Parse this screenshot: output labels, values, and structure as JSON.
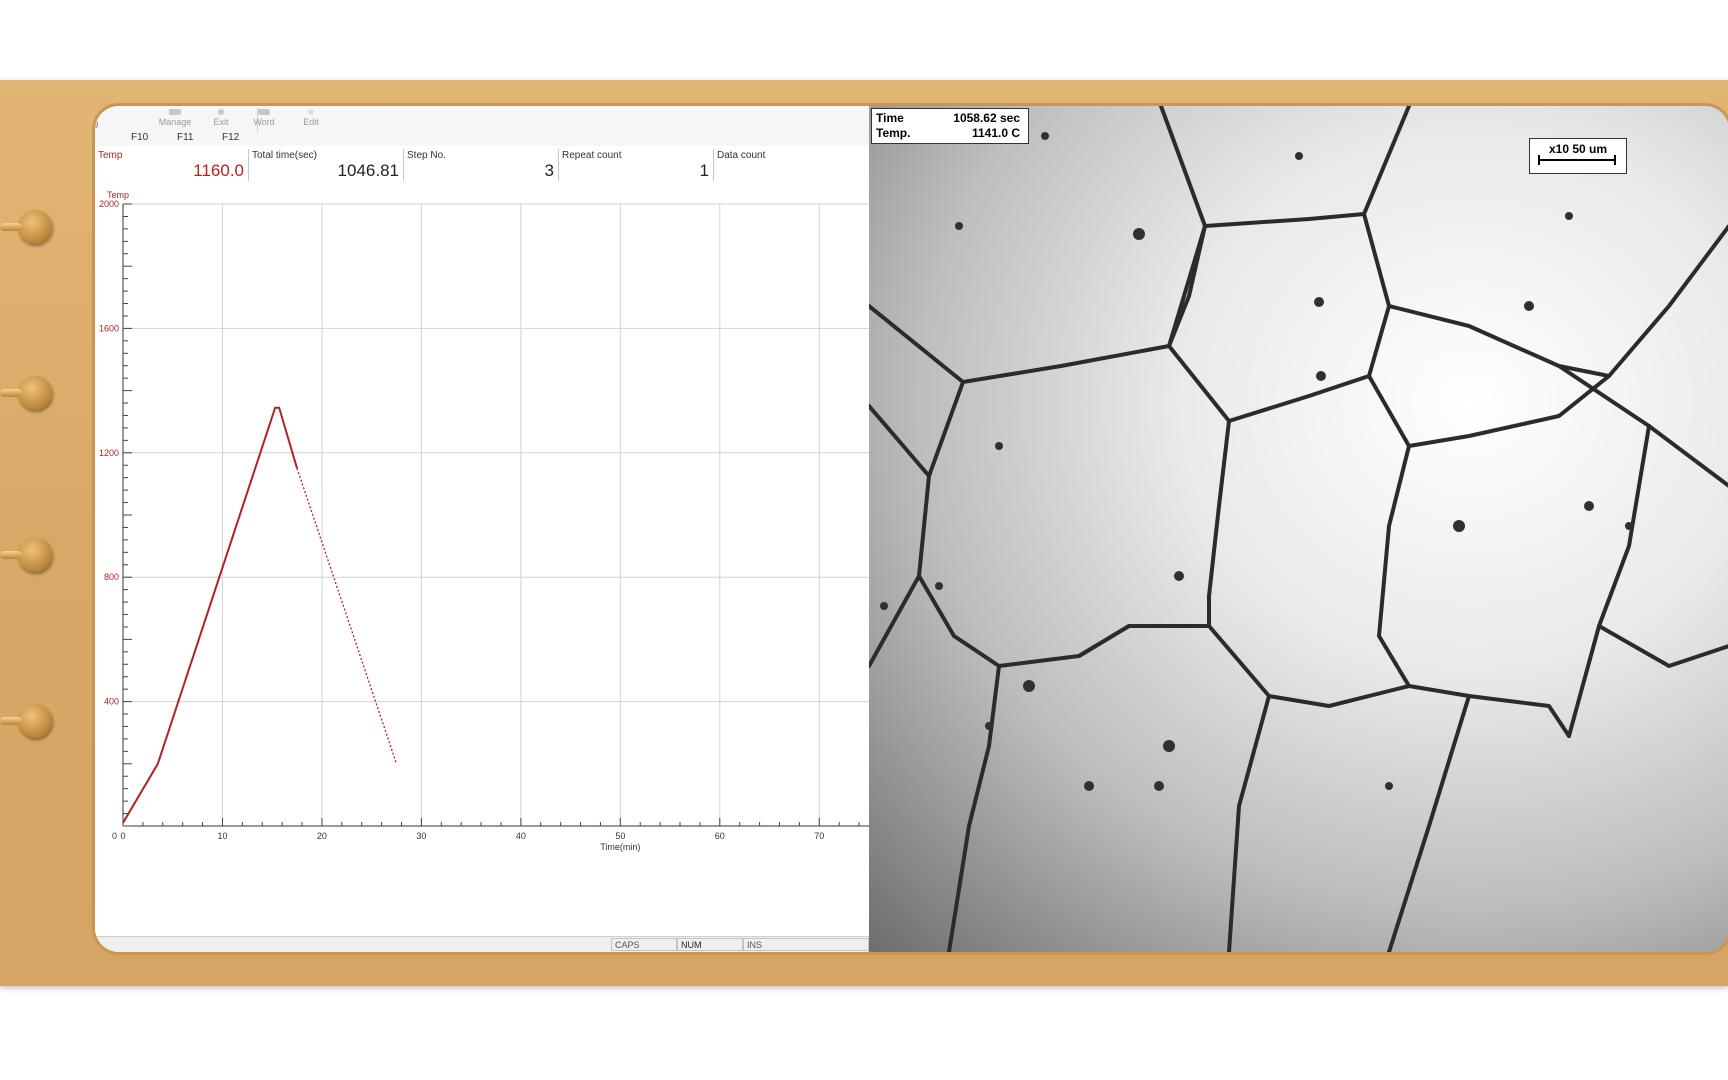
{
  "toolbar": {
    "buttons": [
      {
        "label": "Manage",
        "fkey": "F10"
      },
      {
        "label": "Exit",
        "fkey": "F11"
      },
      {
        "label": "Word",
        "fkey": "F12"
      },
      {
        "label": "Edit"
      }
    ],
    "first_fkey_hint": "9"
  },
  "fields": [
    {
      "label": "Temp",
      "value": "1160.0",
      "color": "#b22222"
    },
    {
      "label": "Total time(sec)",
      "value": "1046.81"
    },
    {
      "label": "Step No.",
      "value": "3"
    },
    {
      "label": "Repeat count",
      "value": "1"
    },
    {
      "label": "Data count",
      "value": ""
    }
  ],
  "statusbar": [
    "CAPS",
    "NUM",
    "INS"
  ],
  "chart_data": {
    "type": "line",
    "ylabel": "Temp",
    "xlabel": "Time(min)",
    "xlim": [
      0,
      75
    ],
    "ylim": [
      0,
      2000
    ],
    "x_ticks": [
      0,
      10,
      20,
      30,
      40,
      50,
      60,
      70
    ],
    "x_tick_labels": [
      "0",
      "10",
      "20",
      "30",
      "40",
      "50",
      "60",
      "70"
    ],
    "y_ticks": [
      400,
      800,
      1200,
      1600,
      2000
    ],
    "y_tick_labels": [
      "400",
      "800",
      "1200",
      "1600",
      "2000"
    ],
    "grid": true,
    "line_color": "#b22222",
    "series": [
      {
        "style": "solid",
        "x": [
          0,
          3.5,
          15.3,
          15.7,
          17.5
        ],
        "y": [
          10,
          200,
          1345,
          1345,
          1150
        ]
      },
      {
        "style": "dotted",
        "x": [
          17.5,
          27.5
        ],
        "y": [
          1150,
          200
        ]
      }
    ]
  },
  "micrograph": {
    "time_label": "Time",
    "time_value": "1058.62 sec",
    "temp_label": "Temp.",
    "temp_value": "1141.0 C",
    "scale_label": "x10  50 um"
  }
}
